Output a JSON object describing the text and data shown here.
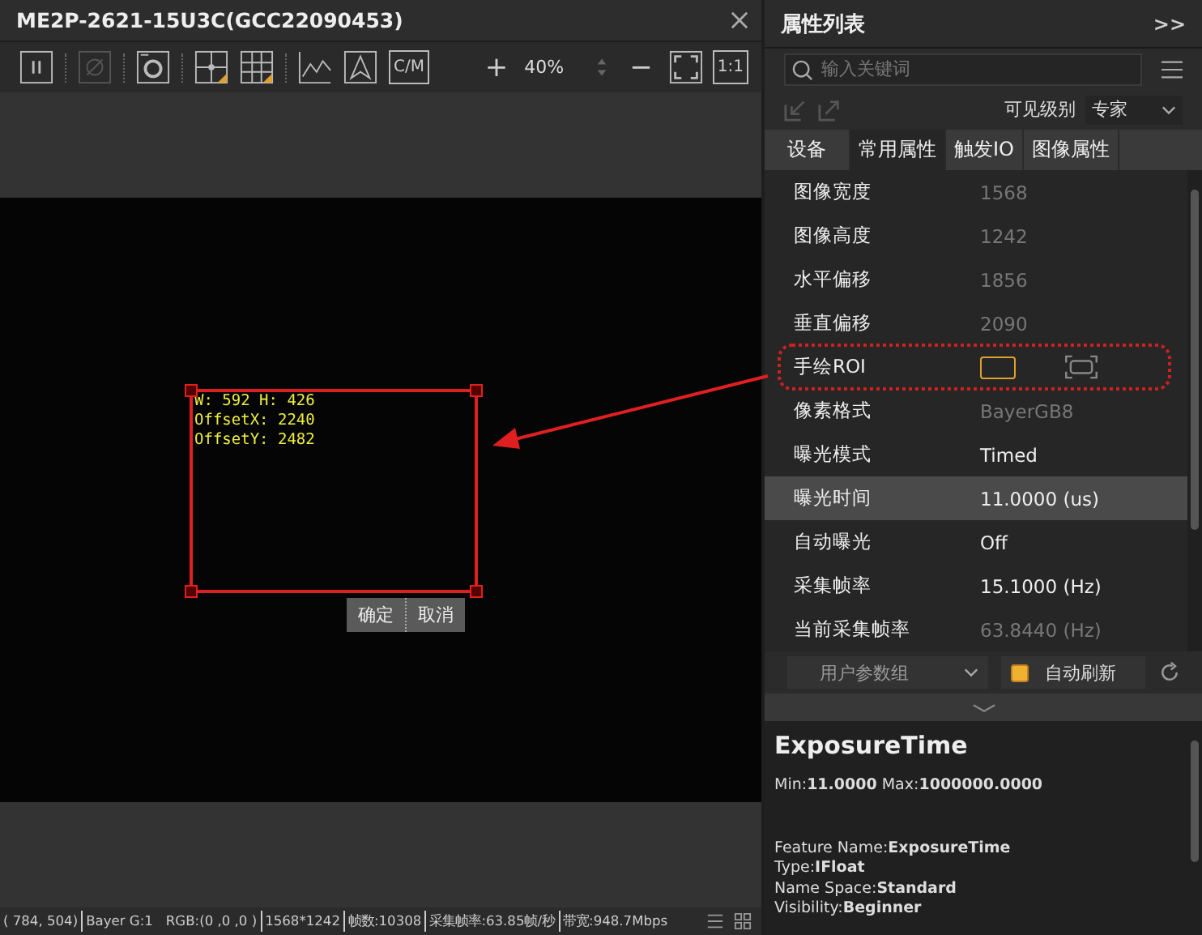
{
  "viewer": {
    "title": "ME2P-2621-15U3C(GCC22090453)",
    "toolbar": [
      {
        "kind": "pause",
        "disabled": false
      },
      {
        "kind": "sep"
      },
      {
        "kind": "hide",
        "disabled": true
      },
      {
        "kind": "sep"
      },
      {
        "kind": "snapshot",
        "disabled": false
      },
      {
        "kind": "sep"
      },
      {
        "kind": "crosshair",
        "disabled": false
      },
      {
        "kind": "grid",
        "disabled": false
      },
      {
        "kind": "sep"
      },
      {
        "kind": "chart",
        "disabled": false
      },
      {
        "kind": "marker",
        "disabled": false
      },
      {
        "kind": "label",
        "text": "C/M",
        "disabled": false
      }
    ],
    "zoom": {
      "plus": "+",
      "value": "40%",
      "minus": "−",
      "actual_size": "1:1"
    },
    "roi": {
      "info": [
        "W: 592 H: 426",
        "OffsetX: 2240",
        "OffsetY: 2482"
      ],
      "confirm": "确定",
      "cancel": "取消"
    },
    "status_bar": [
      "( 784, 504)",
      "Bayer G:1",
      "RGB:(0 ,0 ,0 )",
      "1568*1242",
      "帧数:10308",
      "采集帧率:63.85帧/秒",
      "带宽:948.7Mbps"
    ]
  },
  "properties_panel": {
    "title": "属性列表",
    "collapse": ">>",
    "search": {
      "placeholder": "输入关键词"
    },
    "visibility_label": "可见级别",
    "visibility": "专家",
    "tabs": [
      {
        "label": "设备",
        "selected": false
      },
      {
        "label": "常用属性",
        "selected": true
      },
      {
        "label": "触发IO",
        "selected": false
      },
      {
        "label": "图像属性",
        "selected": false
      }
    ],
    "rows": [
      {
        "kind": "text",
        "label": "图像宽度",
        "value": "1568",
        "disabled": true,
        "selected": false
      },
      {
        "kind": "text",
        "label": "图像高度",
        "value": "1242",
        "disabled": true,
        "selected": false
      },
      {
        "kind": "text",
        "label": "水平偏移",
        "value": "1856",
        "disabled": true,
        "selected": false
      },
      {
        "kind": "text",
        "label": "垂直偏移",
        "value": "2090",
        "disabled": true,
        "selected": false
      },
      {
        "kind": "roi",
        "label": "手绘ROI",
        "disabled": false,
        "selected": false
      },
      {
        "kind": "text",
        "label": "像素格式",
        "value": "BayerGB8",
        "disabled": true,
        "selected": false
      },
      {
        "kind": "text",
        "label": "曝光模式",
        "value": "Timed",
        "disabled": false,
        "selected": false
      },
      {
        "kind": "text",
        "label": "曝光时间",
        "value": "11.0000 (us)",
        "disabled": false,
        "selected": true
      },
      {
        "kind": "text",
        "label": "自动曝光",
        "value": "Off",
        "disabled": false,
        "selected": false
      },
      {
        "kind": "text",
        "label": "采集帧率",
        "value": "15.1000 (Hz)",
        "disabled": false,
        "selected": false
      },
      {
        "kind": "text",
        "label": "当前采集帧率",
        "value": "63.8440 (Hz)",
        "disabled": true,
        "selected": false
      }
    ],
    "user_set": "用户参数组",
    "auto_refresh": {
      "label": "自动刷新",
      "checked": true
    },
    "description": {
      "title": "ExposureTime",
      "range": "Min:**11.0000** Max:**1000000.0000**",
      "details": [
        "Feature Name:**ExposureTime**",
        "Type:**IFloat**",
        "Name Space:**Standard**",
        "Visibility:**Beginner**"
      ]
    }
  }
}
